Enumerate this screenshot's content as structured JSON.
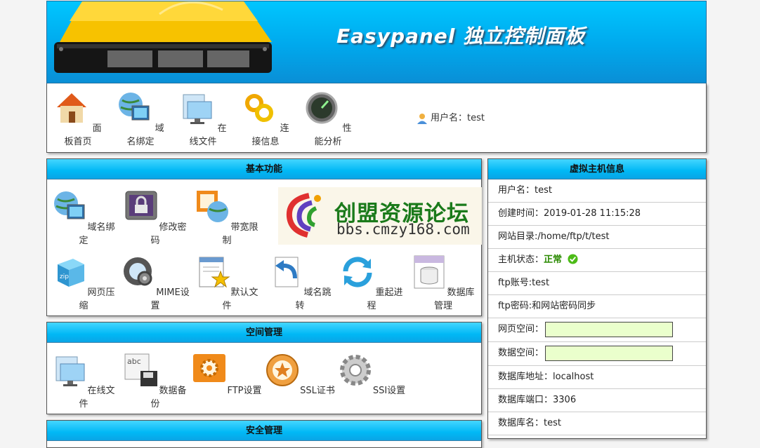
{
  "header": {
    "brand": "Easypanel 独立控制面板"
  },
  "toolbar": {
    "items": [
      {
        "label": "面板首页",
        "icon": "home-icon"
      },
      {
        "label": "域名绑定",
        "icon": "globe-screen-icon"
      },
      {
        "label": "在线文件",
        "icon": "folder-screen-icon"
      },
      {
        "label": "连接信息",
        "icon": "link-icon"
      },
      {
        "label": "性能分析",
        "icon": "gauge-icon"
      }
    ],
    "user_label": "用户名：",
    "user_value": "test"
  },
  "basic": {
    "title": "基本功能",
    "items": [
      {
        "label": "域名绑定",
        "icon": "globe-screen-icon"
      },
      {
        "label": "修改密码",
        "icon": "lock-icon"
      },
      {
        "label": "带宽限制",
        "icon": "bandwidth-icon"
      },
      {
        "label": "网页压缩",
        "icon": "zip-icon"
      },
      {
        "label": "MIME设置",
        "icon": "mime-icon"
      },
      {
        "label": "默认文件",
        "icon": "default-file-icon"
      },
      {
        "label": "域名跳转",
        "icon": "redirect-icon"
      },
      {
        "label": "重起进程",
        "icon": "restart-icon"
      },
      {
        "label": "数据库管理",
        "icon": "database-icon"
      }
    ]
  },
  "space": {
    "title": "空间管理",
    "items": [
      {
        "label": "在线文件",
        "icon": "folder-screen-icon"
      },
      {
        "label": "数据备份",
        "icon": "backup-icon"
      },
      {
        "label": "FTP设置",
        "icon": "ftp-gear-icon"
      },
      {
        "label": "SSL证书",
        "icon": "ssl-icon"
      },
      {
        "label": "SSI设置",
        "icon": "ssi-gear-icon"
      }
    ]
  },
  "security": {
    "title": "安全管理"
  },
  "host": {
    "title": "虚拟主机信息",
    "username": "用户名：test",
    "created": "创建时间：2019-01-28 11:15:28",
    "webdir": "网站目录:/home/ftp/t/test",
    "status_label": "主机状态：",
    "status_value": "正常",
    "ftp_account": "ftp账号:test",
    "ftp_password": "ftp密码:和网站密码同步",
    "web_space_label": "网页空间：",
    "db_space_label": "数据空间：",
    "db_address": "数据库地址：localhost",
    "db_port": "数据库端口：3306",
    "db_name": "数据库名：test"
  },
  "watermark": {
    "title": "创盟资源论坛",
    "url": "bbs.cmzy168.com"
  },
  "colors": {
    "header": "#00b4f5",
    "title_bar": "#00b8f5",
    "space_bar": "#eaffcc",
    "ok": "#2a8a00"
  }
}
